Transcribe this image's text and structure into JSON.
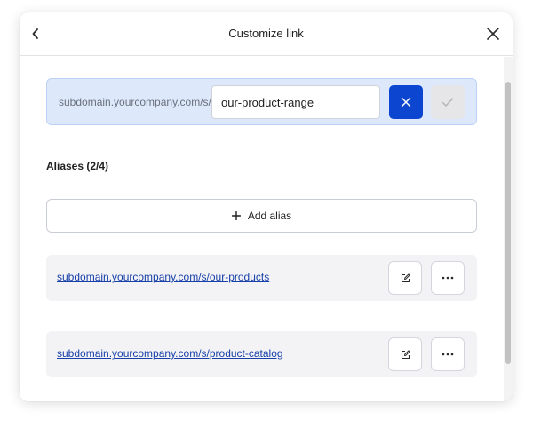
{
  "header": {
    "title": "Customize link",
    "back_icon": "chevron-left-icon",
    "close_icon": "close-icon"
  },
  "editor": {
    "prefix": "subdomain.yourcompany.com/s/",
    "slug_value": "our-product-range",
    "cancel_icon": "close-icon",
    "confirm_icon": "check-icon",
    "accent_color": "#0b45d0",
    "background_color": "#dde9fb"
  },
  "aliases": {
    "heading": "Aliases (2/4)",
    "add_label": "Add alias",
    "add_icon": "plus-icon",
    "items": [
      {
        "url": "subdomain.yourcompany.com/s/our-products",
        "edit_icon": "edit-icon",
        "more_icon": "more-horizontal-icon"
      },
      {
        "url": "subdomain.yourcompany.com/s/product-catalog",
        "edit_icon": "edit-icon",
        "more_icon": "more-horizontal-icon"
      }
    ]
  }
}
